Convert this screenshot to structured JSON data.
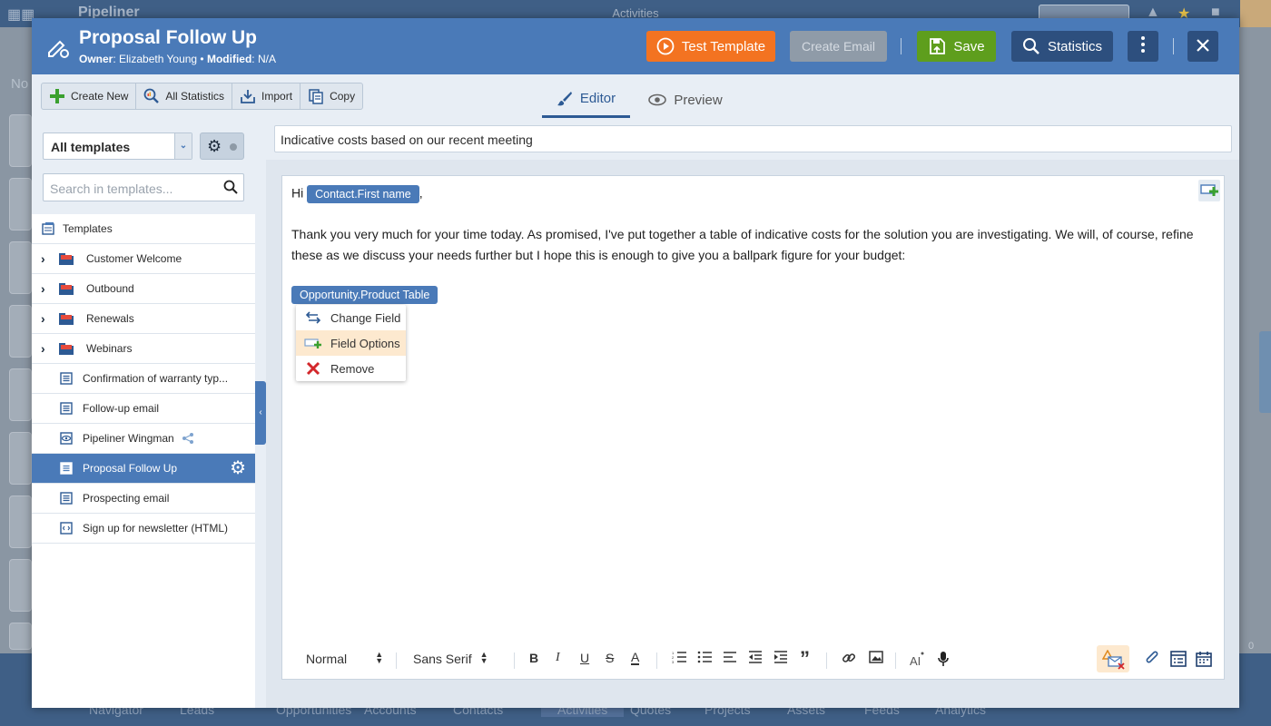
{
  "background": {
    "app_name": "Pipeliner",
    "section_title": "Activities",
    "left_hint": "No",
    "right_count": "0",
    "nav": [
      "Navigator",
      "Leads",
      "Opportunities",
      "Accounts",
      "Contacts",
      "Activities",
      "Quotes",
      "Projects",
      "Assets",
      "Feeds",
      "Analytics"
    ]
  },
  "header": {
    "title": "Proposal Follow Up",
    "owner_label": "Owner",
    "owner": ": Elizabeth Young • ",
    "modified_label": "Modified",
    "modified": ": N/A",
    "test_template": "Test Template",
    "create_email": "Create Email",
    "save": "Save",
    "statistics": "Statistics",
    "more_icon": "kebab-icon",
    "close_icon": "close-icon"
  },
  "toolbar": {
    "create_new": "Create New",
    "all_statistics": "All Statistics",
    "import": "Import",
    "copy": "Copy"
  },
  "sidebar": {
    "filter_value": "All templates",
    "search_placeholder": "Search in templates...",
    "root_label": "Templates",
    "folders": [
      {
        "label": "Customer Welcome"
      },
      {
        "label": "Outbound"
      },
      {
        "label": "Renewals"
      },
      {
        "label": "Webinars"
      }
    ],
    "items": [
      {
        "label": "Confirmation of warranty typ...",
        "icon": "document-icon"
      },
      {
        "label": "Follow-up email",
        "icon": "document-icon"
      },
      {
        "label": "Pipeliner Wingman",
        "icon": "eye-icon"
      },
      {
        "label": "Proposal Follow Up",
        "icon": "document-icon",
        "selected": true
      },
      {
        "label": "Prospecting email",
        "icon": "document-icon"
      },
      {
        "label": "Sign up for newsletter (HTML)",
        "icon": "html-doc-icon"
      }
    ]
  },
  "tabs": {
    "editor": "Editor",
    "preview": "Preview"
  },
  "editor": {
    "subject": "Indicative costs based on our recent meeting",
    "greeting": "Hi",
    "greeting_field": "Contact.First name",
    "greeting_end": ",",
    "paragraph_line1": "Thank you very much for your time today.  As promised, I've put together a table of indicative costs for the solution you are investigating.  We will, of course, refine",
    "paragraph_line2": "these as we discuss your needs further but I hope this is enough to give you a ballpark figure for your budget:",
    "product_field": "Opportunity.Product Table",
    "context_menu": {
      "change_field": "Change Field",
      "field_options": "Field Options",
      "remove": "Remove"
    }
  },
  "format_bar": {
    "paragraph_style": "Normal",
    "font": "Sans Serif",
    "bold": "B",
    "italic": "I",
    "underline": "U",
    "strike": "S",
    "font_color": "A",
    "quote": "”"
  },
  "colors": {
    "header_blue": "#4a7ab8",
    "test_orange": "#f37321",
    "save_green": "#5e9e1d",
    "dark_blue": "#2d4f7e",
    "highlight": "#fde9cf"
  }
}
